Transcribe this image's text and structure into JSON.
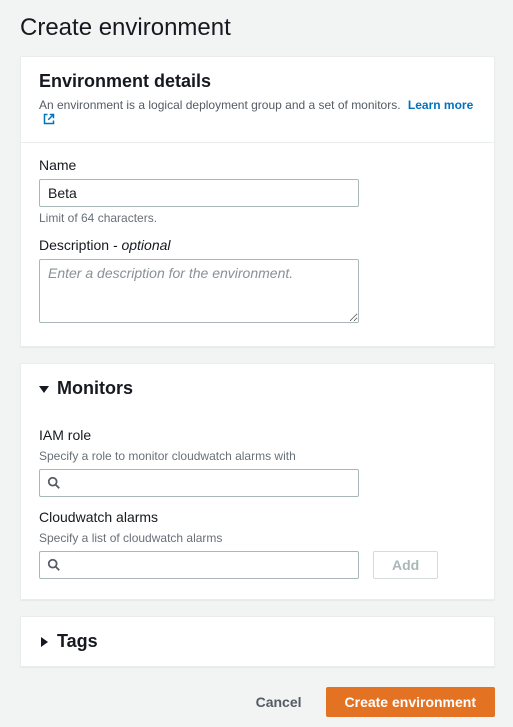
{
  "page": {
    "title": "Create environment"
  },
  "details": {
    "heading": "Environment details",
    "subtitle": "An environment is a logical deployment group and a set of monitors.",
    "learn_more": "Learn more",
    "name_label": "Name",
    "name_value": "Beta",
    "name_hint": "Limit of 64 characters.",
    "desc_label": "Description",
    "desc_optional": "- optional",
    "desc_placeholder": "Enter a description for the environment."
  },
  "monitors": {
    "heading": "Monitors",
    "iam_label": "IAM role",
    "iam_hint": "Specify a role to monitor cloudwatch alarms with",
    "alarms_label": "Cloudwatch alarms",
    "alarms_hint": "Specify a list of cloudwatch alarms",
    "add_label": "Add"
  },
  "tags": {
    "heading": "Tags"
  },
  "footer": {
    "cancel": "Cancel",
    "create": "Create environment"
  }
}
